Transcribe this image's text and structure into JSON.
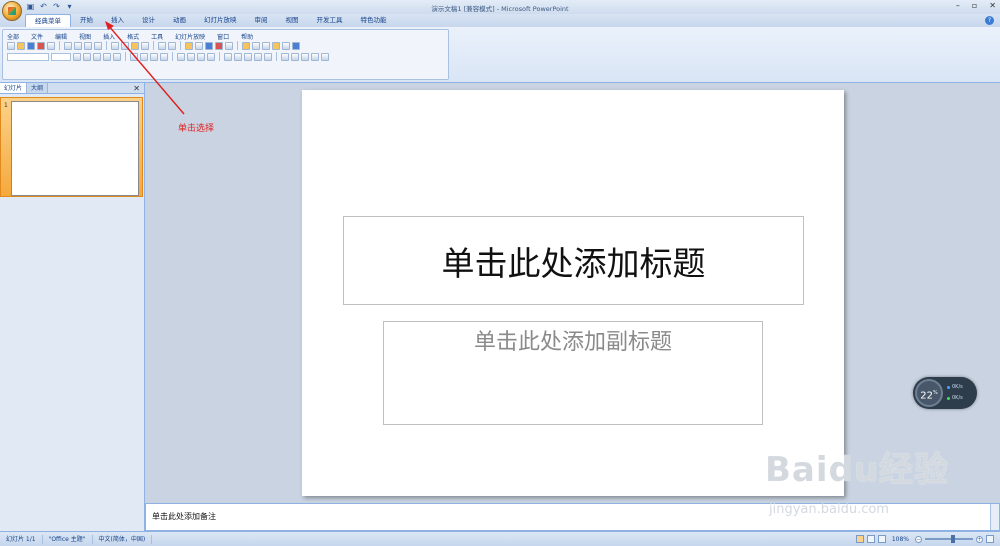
{
  "window": {
    "title": "演示文稿1 [兼容模式] - Microsoft PowerPoint",
    "controls": [
      "–",
      "▫",
      "✕"
    ]
  },
  "quick_access": {
    "icons": [
      "save-icon",
      "undo-icon",
      "redo-icon",
      "customize-icon"
    ]
  },
  "tabs": [
    "经典菜单",
    "开始",
    "插入",
    "设计",
    "动画",
    "幻灯片放映",
    "审阅",
    "视图",
    "开发工具",
    "特色功能"
  ],
  "active_tab": "经典菜单",
  "classic_menu": [
    "全部",
    "文件",
    "编辑",
    "视图",
    "插入",
    "格式",
    "工具",
    "幻灯片放映",
    "窗口",
    "帮助"
  ],
  "left_pane": {
    "tabs": [
      "幻灯片",
      "大纲"
    ],
    "close": "✕",
    "slide_number": "1"
  },
  "slide": {
    "title_placeholder": "单击此处添加标题",
    "subtitle_placeholder": "单击此处添加副标题"
  },
  "notes": {
    "placeholder": "单击此处添加备注"
  },
  "status_bar": {
    "slide_info": "幻灯片 1/1",
    "theme": "\"Office 主题\"",
    "language": "中文(简体，中国)",
    "zoom": "108%"
  },
  "annotation": {
    "text": "单击选择",
    "color": "#e02020"
  },
  "widget": {
    "value": "22",
    "unit": "%",
    "up": "0K/s",
    "down": "0K/s"
  },
  "watermark": {
    "logo": "Baidu经验",
    "url": "jingyan.baidu.com"
  }
}
